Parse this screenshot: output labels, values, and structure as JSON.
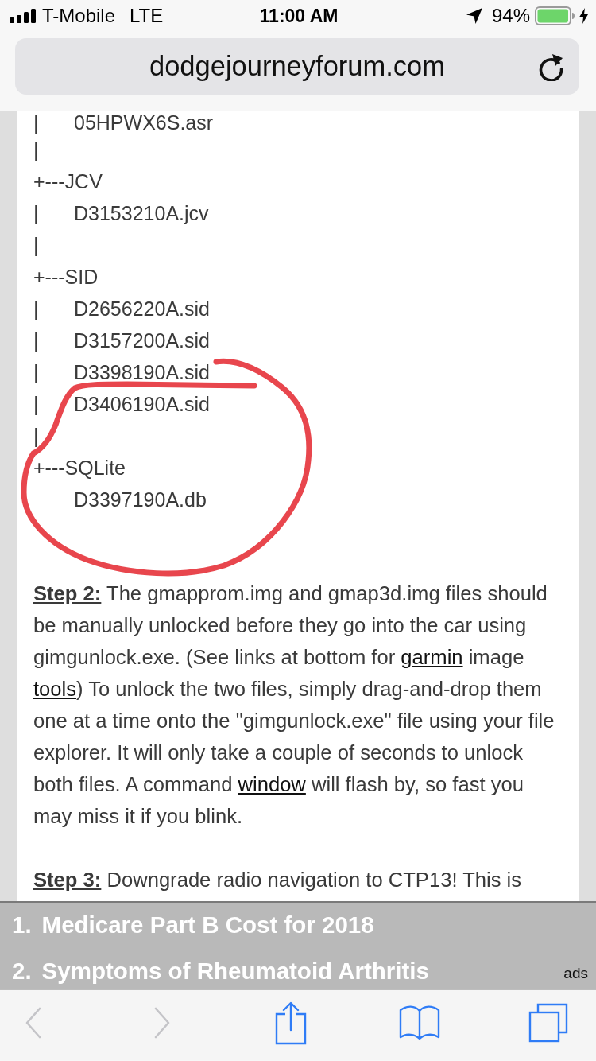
{
  "status_bar": {
    "carrier": "T-Mobile",
    "network": "LTE",
    "time": "11:00 AM",
    "battery": "94%"
  },
  "address_bar": {
    "value": "dodgejourneyforum.com"
  },
  "file_tree": [
    {
      "kind": "file",
      "guide": "|",
      "name": "05HPWX6S.asr"
    },
    {
      "kind": "spacer",
      "guide": "|"
    },
    {
      "kind": "folder",
      "label": "+---JCV",
      "children": [
        {
          "guide": "|",
          "name": "D3153210A.jcv"
        }
      ]
    },
    {
      "kind": "spacer",
      "guide": "|"
    },
    {
      "kind": "folder",
      "label": "+---SID",
      "children": [
        {
          "guide": "|",
          "name": "D2656220A.sid"
        },
        {
          "guide": "|",
          "name": "D3157200A.sid"
        },
        {
          "guide": "|",
          "name": "D3398190A.sid"
        },
        {
          "guide": "|",
          "name": "D3406190A.sid"
        }
      ]
    },
    {
      "kind": "spacer",
      "guide": "|"
    },
    {
      "kind": "folder",
      "label": "+---SQLite",
      "children": [
        {
          "name": "D3397190A.db"
        }
      ]
    }
  ],
  "steps": [
    {
      "segments": [
        {
          "kind": "label",
          "text": "Step 2:"
        },
        {
          "kind": "text",
          "text": " The gmapprom.img and gmap3d.img files should be manually unlocked before they go into the car using gimgunlock.exe. (See links at bottom for "
        },
        {
          "kind": "link",
          "text": "garmin"
        },
        {
          "kind": "text",
          "text": " image "
        },
        {
          "kind": "link",
          "text": "tools"
        },
        {
          "kind": "text",
          "text": ") To unlock the two files, simply drag-and-drop them one at a time onto the \"gimgunlock.exe\" file using your file explorer. It will only take a couple of seconds to unlock both files. A command "
        },
        {
          "kind": "link",
          "text": "window"
        },
        {
          "kind": "text",
          "text": " will flash by, so fast you may miss it if you blink."
        }
      ]
    },
    {
      "segments": [
        {
          "kind": "label",
          "text": "Step 3:"
        },
        {
          "kind": "text",
          "text": " Downgrade radio navigation to CTP13! This is"
        }
      ]
    }
  ],
  "ad_banner": {
    "items": [
      {
        "number": "1.",
        "title": "Medicare Part B Cost for 2018"
      },
      {
        "number": "2.",
        "title": "Symptoms of Rheumatoid Arthritis"
      }
    ],
    "label": "ads"
  },
  "toolbar": [
    {
      "kind": "back",
      "disabled": true
    },
    {
      "kind": "forward",
      "disabled": true
    },
    {
      "kind": "share",
      "disabled": false
    },
    {
      "kind": "bookmarks",
      "disabled": false
    },
    {
      "kind": "tabs",
      "disabled": false
    }
  ]
}
